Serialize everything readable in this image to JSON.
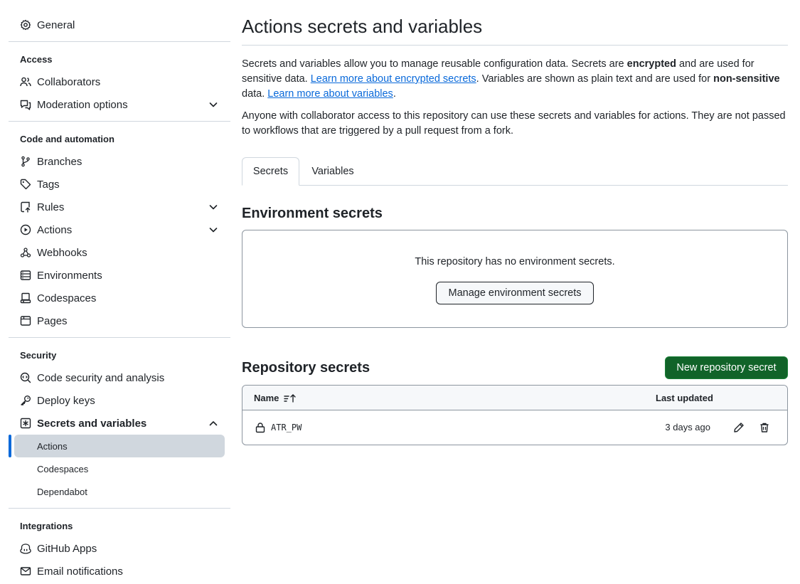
{
  "sidebar": {
    "general": "General",
    "access_heading": "Access",
    "collaborators": "Collaborators",
    "moderation": "Moderation options",
    "code_heading": "Code and automation",
    "branches": "Branches",
    "tags": "Tags",
    "rules": "Rules",
    "actions": "Actions",
    "webhooks": "Webhooks",
    "environments": "Environments",
    "codespaces": "Codespaces",
    "pages": "Pages",
    "security_heading": "Security",
    "code_security": "Code security and analysis",
    "deploy_keys": "Deploy keys",
    "secrets_vars": "Secrets and variables",
    "sub_actions": "Actions",
    "sub_codespaces": "Codespaces",
    "sub_dependabot": "Dependabot",
    "integrations_heading": "Integrations",
    "github_apps": "GitHub Apps",
    "email_notifications": "Email notifications"
  },
  "main": {
    "title": "Actions secrets and variables",
    "intro_1": "Secrets and variables allow you to manage reusable configuration data. Secrets are ",
    "intro_encrypted": "encrypted",
    "intro_2": " and are used for sensitive data. ",
    "intro_link_secrets": "Learn more about encrypted secrets",
    "intro_3": ". Variables are shown as plain text and are used for ",
    "intro_nonsensitive": "non-sensitive",
    "intro_4": " data. ",
    "intro_link_vars": "Learn more about variables",
    "intro_5": ".",
    "access_note": "Anyone with collaborator access to this repository can use these secrets and variables for actions. They are not passed to workflows that are triggered by a pull request from a fork.",
    "tabs": [
      {
        "label": "Secrets",
        "selected": true
      },
      {
        "label": "Variables",
        "selected": false
      }
    ],
    "env_secrets_title": "Environment secrets",
    "env_empty": "This repository has no environment secrets.",
    "manage_env_button": "Manage environment secrets",
    "repo_secrets_title": "Repository secrets",
    "new_secret_button": "New repository secret",
    "table": {
      "col_name": "Name",
      "col_updated": "Last updated",
      "rows": [
        {
          "name": "ATR_PW",
          "updated": "3 days ago"
        }
      ]
    }
  },
  "colors": {
    "accent": "#0969da",
    "primary_button": "#116329",
    "border": "#d0d7de"
  }
}
